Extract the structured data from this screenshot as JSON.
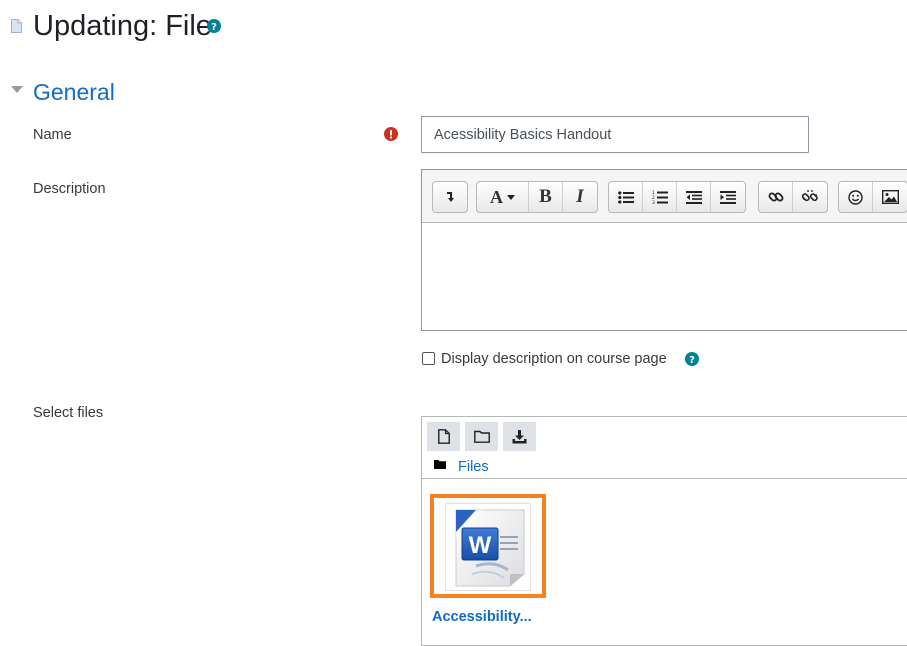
{
  "page": {
    "title": "Updating: File",
    "title_icon": "file-icon",
    "help_icon": "question-circle-icon"
  },
  "section": {
    "title": "General",
    "toggle_icon": "caret-down-icon"
  },
  "form": {
    "name": {
      "label": "Name",
      "value": "Acessibility Basics Handout",
      "required_icon": "exclamation-circle-icon"
    },
    "description": {
      "label": "Description",
      "value": "",
      "toolbar": [
        {
          "group": "misc",
          "buttons": [
            "collapse-icon"
          ]
        },
        {
          "group": "style",
          "buttons": [
            "paragraph-styles-icon",
            "bold-icon",
            "italic-icon"
          ]
        },
        {
          "group": "list",
          "buttons": [
            "unordered-list-icon",
            "ordered-list-icon",
            "outdent-icon",
            "indent-icon"
          ]
        },
        {
          "group": "links",
          "buttons": [
            "link-icon",
            "unlink-icon"
          ]
        },
        {
          "group": "insert",
          "buttons": [
            "emoji-icon",
            "image-icon"
          ]
        }
      ],
      "style_button_label": "A",
      "bold_label": "B",
      "italic_label": "I"
    },
    "show_description": {
      "label": "Display description on course page",
      "checked": false
    },
    "files": {
      "label": "Select files",
      "toolbar": [
        "add-file-icon",
        "create-folder-icon",
        "download-icon"
      ],
      "path_label": "Files",
      "path_icon": "folder-icon",
      "items": [
        {
          "name": "Accessibility...",
          "icon": "word-document-icon"
        }
      ]
    }
  },
  "colors": {
    "link": "#0f6cbf",
    "required": "#ca3120",
    "help": "#008196",
    "highlight": "#f58220"
  }
}
